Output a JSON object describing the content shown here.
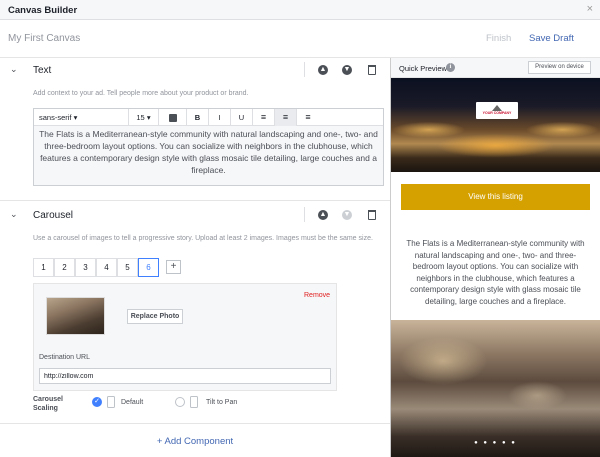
{
  "window": {
    "title": "Canvas Builder",
    "close": "×"
  },
  "header": {
    "canvas_name": "My First Canvas",
    "finish": "Finish",
    "save_draft": "Save Draft"
  },
  "text_section": {
    "title": "Text",
    "description": "Add context to your ad. Tell people more about your product or brand.",
    "toolbar": {
      "font": "sans-serif ▾",
      "size": "15",
      "size_arrow": "▾",
      "bold": "B",
      "italic": "I",
      "underline": "U"
    },
    "body": "The Flats is a Mediterranean-style community with natural landscaping and one-, two- and three-bedroom layout options. You can socialize with neighbors in the clubhouse, which features a contemporary design style with glass mosaic tile detailing, large couches and a fireplace."
  },
  "carousel_section": {
    "title": "Carousel",
    "description": "Use a carousel of images to tell a progressive story. Upload at least 2 images. Images must be the same size.",
    "cards": [
      "1",
      "2",
      "3",
      "4",
      "5",
      "6"
    ],
    "selected_card": "6",
    "add_card": "+",
    "remove": "Remove",
    "replace_photo": "Replace Photo",
    "destination_label": "Destination URL",
    "destination_url": "http://zillow.com",
    "scaling_label": "Carousel Scaling",
    "option_default": "Default",
    "option_tilt": "Tilt to Pan"
  },
  "add_component": "+ Add Component",
  "preview": {
    "title": "Quick Preview",
    "info": "i",
    "device_button": "Preview on device",
    "logo_text": "YOUR COMPANY",
    "cta": "View this listing",
    "body": "The Flats is a Mediterranean-style community with natural landscaping and one-, two- and three-bedroom layout options. You can socialize with neighbors in the clubhouse, which features a contemporary design style with glass mosaic tile detailing, large couches and a fireplace.",
    "dots": "● ● ● ● ●"
  },
  "colors": {
    "accent_blue": "#4267b2",
    "cta_gold": "#d4a100",
    "remove_red": "#e02020"
  }
}
